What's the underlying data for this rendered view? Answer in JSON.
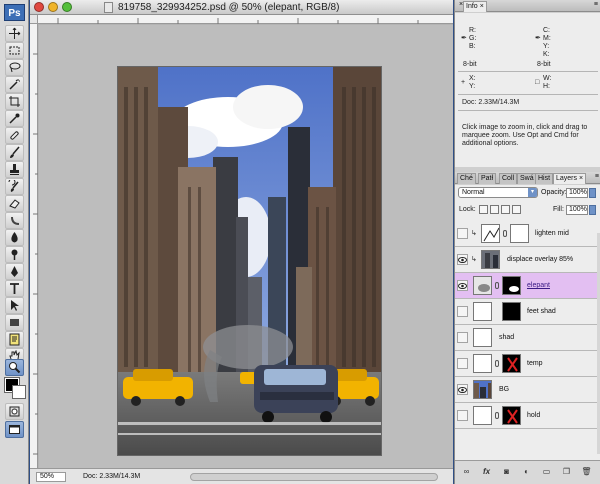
{
  "app": {
    "logo": "Ps"
  },
  "document": {
    "title": "819758_329934252.psd @ 50% (elepant, RGB/8)",
    "zoom": "50%",
    "doc_size": "Doc: 2.33M/14.3M"
  },
  "tools": [
    {
      "icon": "move-tool-icon"
    },
    {
      "icon": "marquee-tool-icon"
    },
    {
      "icon": "lasso-tool-icon"
    },
    {
      "icon": "magic-wand-tool-icon"
    },
    {
      "icon": "crop-tool-icon"
    },
    {
      "icon": "eyedropper-tool-icon"
    },
    {
      "icon": "healing-brush-tool-icon"
    },
    {
      "icon": "brush-tool-icon"
    },
    {
      "icon": "clone-stamp-tool-icon"
    },
    {
      "icon": "history-brush-tool-icon"
    },
    {
      "icon": "eraser-tool-icon"
    },
    {
      "icon": "gradient-tool-icon"
    },
    {
      "icon": "blur-tool-icon"
    },
    {
      "icon": "dodge-tool-icon"
    },
    {
      "icon": "pen-tool-icon"
    },
    {
      "icon": "type-tool-icon"
    },
    {
      "icon": "path-selection-tool-icon"
    },
    {
      "icon": "shape-tool-icon"
    },
    {
      "icon": "notes-tool-icon"
    },
    {
      "icon": "eyedropper-2-tool-icon"
    },
    {
      "icon": "hand-tool-icon"
    },
    {
      "icon": "zoom-tool-icon"
    }
  ],
  "info_panel": {
    "tab": "Info",
    "r": "R:",
    "g": "G:",
    "b": "B:",
    "c": "C:",
    "m": "M:",
    "y": "Y:",
    "k": "K:",
    "bit_left": "8-bit",
    "bit_right": "8-bit",
    "x": "X:",
    "y_coord": "Y:",
    "w": "W:",
    "h": "H:",
    "doc": "Doc: 2.33M/14.3M",
    "hint": [
      "Click image to zoom in, click and drag to",
      "marquee zoom.  Use Opt and Cmd for",
      "additional options."
    ]
  },
  "layers_panel": {
    "tabs": [
      "Ché",
      "Patł",
      "Coll",
      "Swá",
      "Hist",
      "Layers"
    ],
    "active_tab": "Layers",
    "blend_mode": "Normal",
    "opacity_label": "Opacity:",
    "opacity": "100%",
    "lock_label": "Lock:",
    "fill_label": "Fill:",
    "fill": "100%",
    "layers": [
      {
        "name": "lighten mid",
        "visible": false,
        "selected": false
      },
      {
        "name": "displace overlay 85%",
        "visible": true,
        "selected": false
      },
      {
        "name": "elepant",
        "visible": true,
        "selected": true
      },
      {
        "name": "feet shad",
        "visible": false,
        "selected": false
      },
      {
        "name": "shad",
        "visible": false,
        "selected": false
      },
      {
        "name": "temp",
        "visible": false,
        "selected": false
      },
      {
        "name": "BG",
        "visible": true,
        "selected": false
      },
      {
        "name": "hold",
        "visible": false,
        "selected": false
      }
    ],
    "footer_buttons": [
      "link-icon",
      "fx-icon",
      "mask-icon",
      "adjustment-icon",
      "group-icon",
      "new-layer-icon",
      "trash-icon"
    ]
  },
  "colors": {
    "selected_row": "#e3bff2",
    "accent": "#6f92c7"
  }
}
